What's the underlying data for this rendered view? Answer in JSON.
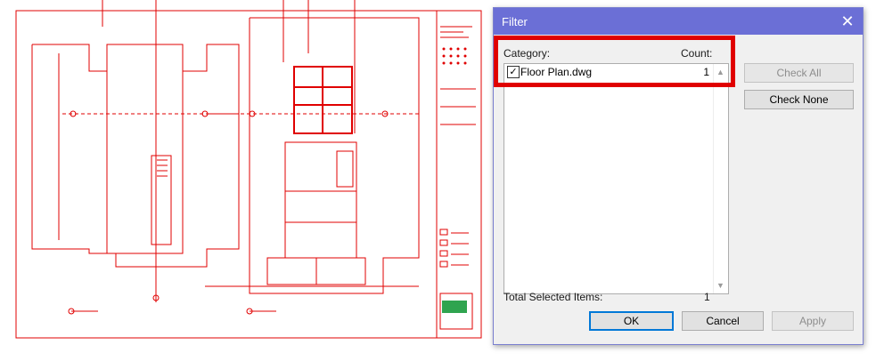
{
  "dialog": {
    "title": "Filter",
    "close_glyph": "✕",
    "category_header": "Category:",
    "count_header": "Count:",
    "items": [
      {
        "name": "Floor Plan.dwg",
        "count": "1",
        "checked": true
      }
    ],
    "check_glyph": "✓",
    "scroll_up": "▲",
    "scroll_down": "▼",
    "total_label": "Total Selected Items:",
    "total_value": "1",
    "buttons": {
      "check_all": "Check All",
      "check_none": "Check None",
      "ok": "OK",
      "cancel": "Cancel",
      "apply": "Apply"
    }
  },
  "colors": {
    "drawing_lines": "#e00000",
    "titlebar": "#6b6fd6",
    "highlight": "#e00000"
  }
}
